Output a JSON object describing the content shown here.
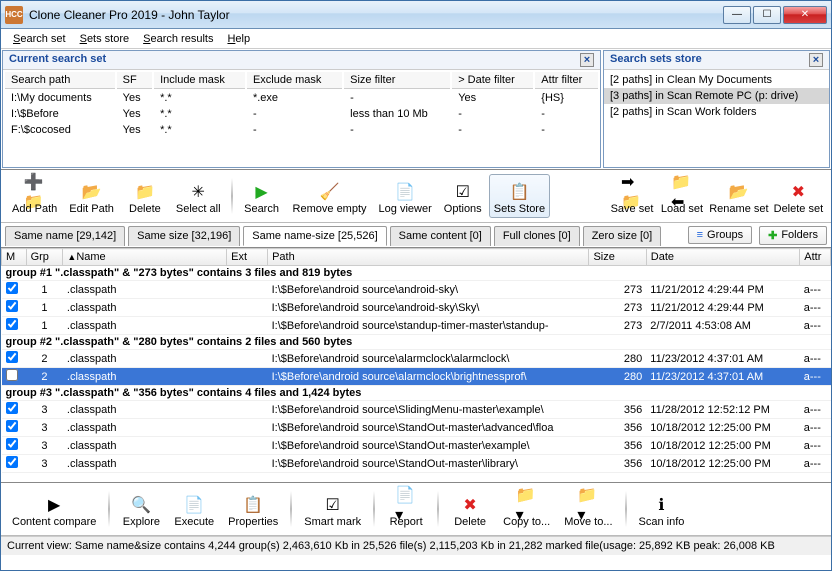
{
  "window": {
    "title": "Clone Cleaner Pro 2019 - John Taylor"
  },
  "menu": [
    "Search set",
    "Sets store",
    "Search results",
    "Help"
  ],
  "searchSet": {
    "title": "Current search set",
    "headers": [
      "Search path",
      "SF",
      "Include mask",
      "Exclude mask",
      "Size filter",
      "> Date filter",
      "Attr filter"
    ],
    "rows": [
      [
        "I:\\My documents",
        "Yes",
        "*.*",
        "*.exe",
        "-",
        "Yes",
        "{HS}"
      ],
      [
        "I:\\$Before",
        "Yes",
        "*.*",
        "-",
        "less than 10 Mb",
        "-",
        "-"
      ],
      [
        "F:\\$cocosed",
        "Yes",
        "*.*",
        "-",
        "-",
        "-",
        "-"
      ]
    ]
  },
  "setsStore": {
    "title": "Search sets store",
    "items": [
      "[2 paths] in Clean My Documents",
      "[3 paths] in Scan Remote PC (p: drive)",
      "[2 paths] in Scan Work folders"
    ],
    "selected": 1
  },
  "toolbarLeft": [
    {
      "name": "add-path",
      "label": "Add Path",
      "icon": "➕📁"
    },
    {
      "name": "edit-path",
      "label": "Edit Path",
      "icon": "📂"
    },
    {
      "name": "delete-path",
      "label": "Delete",
      "icon": "📁"
    },
    {
      "name": "select-all",
      "label": "Select all",
      "icon": "✳"
    }
  ],
  "toolbarMid": [
    {
      "name": "search",
      "label": "Search",
      "icon": "▶",
      "color": "#2a2"
    },
    {
      "name": "remove-empty",
      "label": "Remove empty",
      "icon": "🧹"
    },
    {
      "name": "log-viewer",
      "label": "Log viewer",
      "icon": "📄"
    },
    {
      "name": "options",
      "label": "Options",
      "icon": "☑"
    },
    {
      "name": "sets-store",
      "label": "Sets Store",
      "icon": "📋",
      "pressed": true
    }
  ],
  "toolbarRight": [
    {
      "name": "save-set",
      "label": "Save set",
      "icon": "➡📁"
    },
    {
      "name": "load-set",
      "label": "Load set",
      "icon": "📁⬅"
    },
    {
      "name": "rename-set",
      "label": "Rename set",
      "icon": "📂"
    },
    {
      "name": "delete-set",
      "label": "Delete set",
      "icon": "✖",
      "color": "#d22"
    }
  ],
  "tabs": [
    {
      "label": "Same name [29,142]"
    },
    {
      "label": "Same size [32,196]"
    },
    {
      "label": "Same name-size [25,526]",
      "active": true
    },
    {
      "label": "Same content [0]"
    },
    {
      "label": "Full clones [0]"
    },
    {
      "label": "Zero size [0]"
    }
  ],
  "tabButtons": {
    "groups": "Groups",
    "folders": "Folders"
  },
  "gridHeaders": [
    "M",
    "Grp",
    "Name",
    "Ext",
    "Path",
    "Size",
    "Date",
    "Attr"
  ],
  "groups": [
    {
      "header": "group #1 \".classpath\" & \"273 bytes\" contains 3 files and 819 bytes",
      "rows": [
        {
          "m": true,
          "grp": "1",
          "name": ".classpath",
          "path": "I:\\$Before\\android source\\android-sky\\",
          "size": "273",
          "date": "11/21/2012 4:29:44 PM",
          "attr": "a---"
        },
        {
          "m": true,
          "grp": "1",
          "name": ".classpath",
          "path": "I:\\$Before\\android source\\android-sky\\Sky\\",
          "size": "273",
          "date": "11/21/2012 4:29:44 PM",
          "attr": "a---"
        },
        {
          "m": true,
          "grp": "1",
          "name": ".classpath",
          "path": "I:\\$Before\\android source\\standup-timer-master\\standup-",
          "size": "273",
          "date": "2/7/2011 4:53:08 AM",
          "attr": "a---"
        }
      ]
    },
    {
      "header": "group #2 \".classpath\" & \"280 bytes\" contains 2 files and 560 bytes",
      "rows": [
        {
          "m": true,
          "grp": "2",
          "name": ".classpath",
          "path": "I:\\$Before\\android source\\alarmclock\\alarmclock\\",
          "size": "280",
          "date": "11/23/2012 4:37:01 AM",
          "attr": "a---"
        },
        {
          "m": false,
          "grp": "2",
          "name": ".classpath",
          "path": "I:\\$Before\\android source\\alarmclock\\brightnessprof\\",
          "size": "280",
          "date": "11/23/2012 4:37:01 AM",
          "attr": "a---",
          "sel": true
        }
      ]
    },
    {
      "header": "group #3 \".classpath\" & \"356 bytes\" contains 4 files and 1,424 bytes",
      "rows": [
        {
          "m": true,
          "grp": "3",
          "name": ".classpath",
          "path": "I:\\$Before\\android source\\SlidingMenu-master\\example\\",
          "size": "356",
          "date": "11/28/2012 12:52:12 PM",
          "attr": "a---"
        },
        {
          "m": true,
          "grp": "3",
          "name": ".classpath",
          "path": "I:\\$Before\\android source\\StandOut-master\\advanced\\floa",
          "size": "356",
          "date": "10/18/2012 12:25:00 PM",
          "attr": "a---"
        },
        {
          "m": true,
          "grp": "3",
          "name": ".classpath",
          "path": "I:\\$Before\\android source\\StandOut-master\\example\\",
          "size": "356",
          "date": "10/18/2012 12:25:00 PM",
          "attr": "a---"
        },
        {
          "m": true,
          "grp": "3",
          "name": ".classpath",
          "path": "I:\\$Before\\android source\\StandOut-master\\library\\",
          "size": "356",
          "date": "10/18/2012 12:25:00 PM",
          "attr": "a---"
        }
      ]
    }
  ],
  "bottomToolbar": [
    {
      "name": "content-compare",
      "label": "Content compare",
      "icon": "▶"
    },
    {
      "name": "explore",
      "label": "Explore",
      "icon": "🔍"
    },
    {
      "name": "execute",
      "label": "Execute",
      "icon": "📄"
    },
    {
      "name": "properties",
      "label": "Properties",
      "icon": "📋"
    },
    {
      "name": "smart-mark",
      "label": "Smart mark",
      "icon": "☑"
    },
    {
      "name": "report",
      "label": "Report",
      "icon": "📄▾"
    },
    {
      "name": "delete-files",
      "label": "Delete",
      "icon": "✖",
      "color": "#d22"
    },
    {
      "name": "copy-to",
      "label": "Copy to...",
      "icon": "📁▾"
    },
    {
      "name": "move-to",
      "label": "Move to...",
      "icon": "📁▾"
    },
    {
      "name": "scan-info",
      "label": "Scan info",
      "icon": "ℹ"
    }
  ],
  "status": "Current view: Same name&size contains 4,244 group(s)   2,463,610 Kb in 25,526 file(s)   2,115,203 Kb in 21,282 marked file(usage: 25,892 KB peak: 26,008 KB"
}
